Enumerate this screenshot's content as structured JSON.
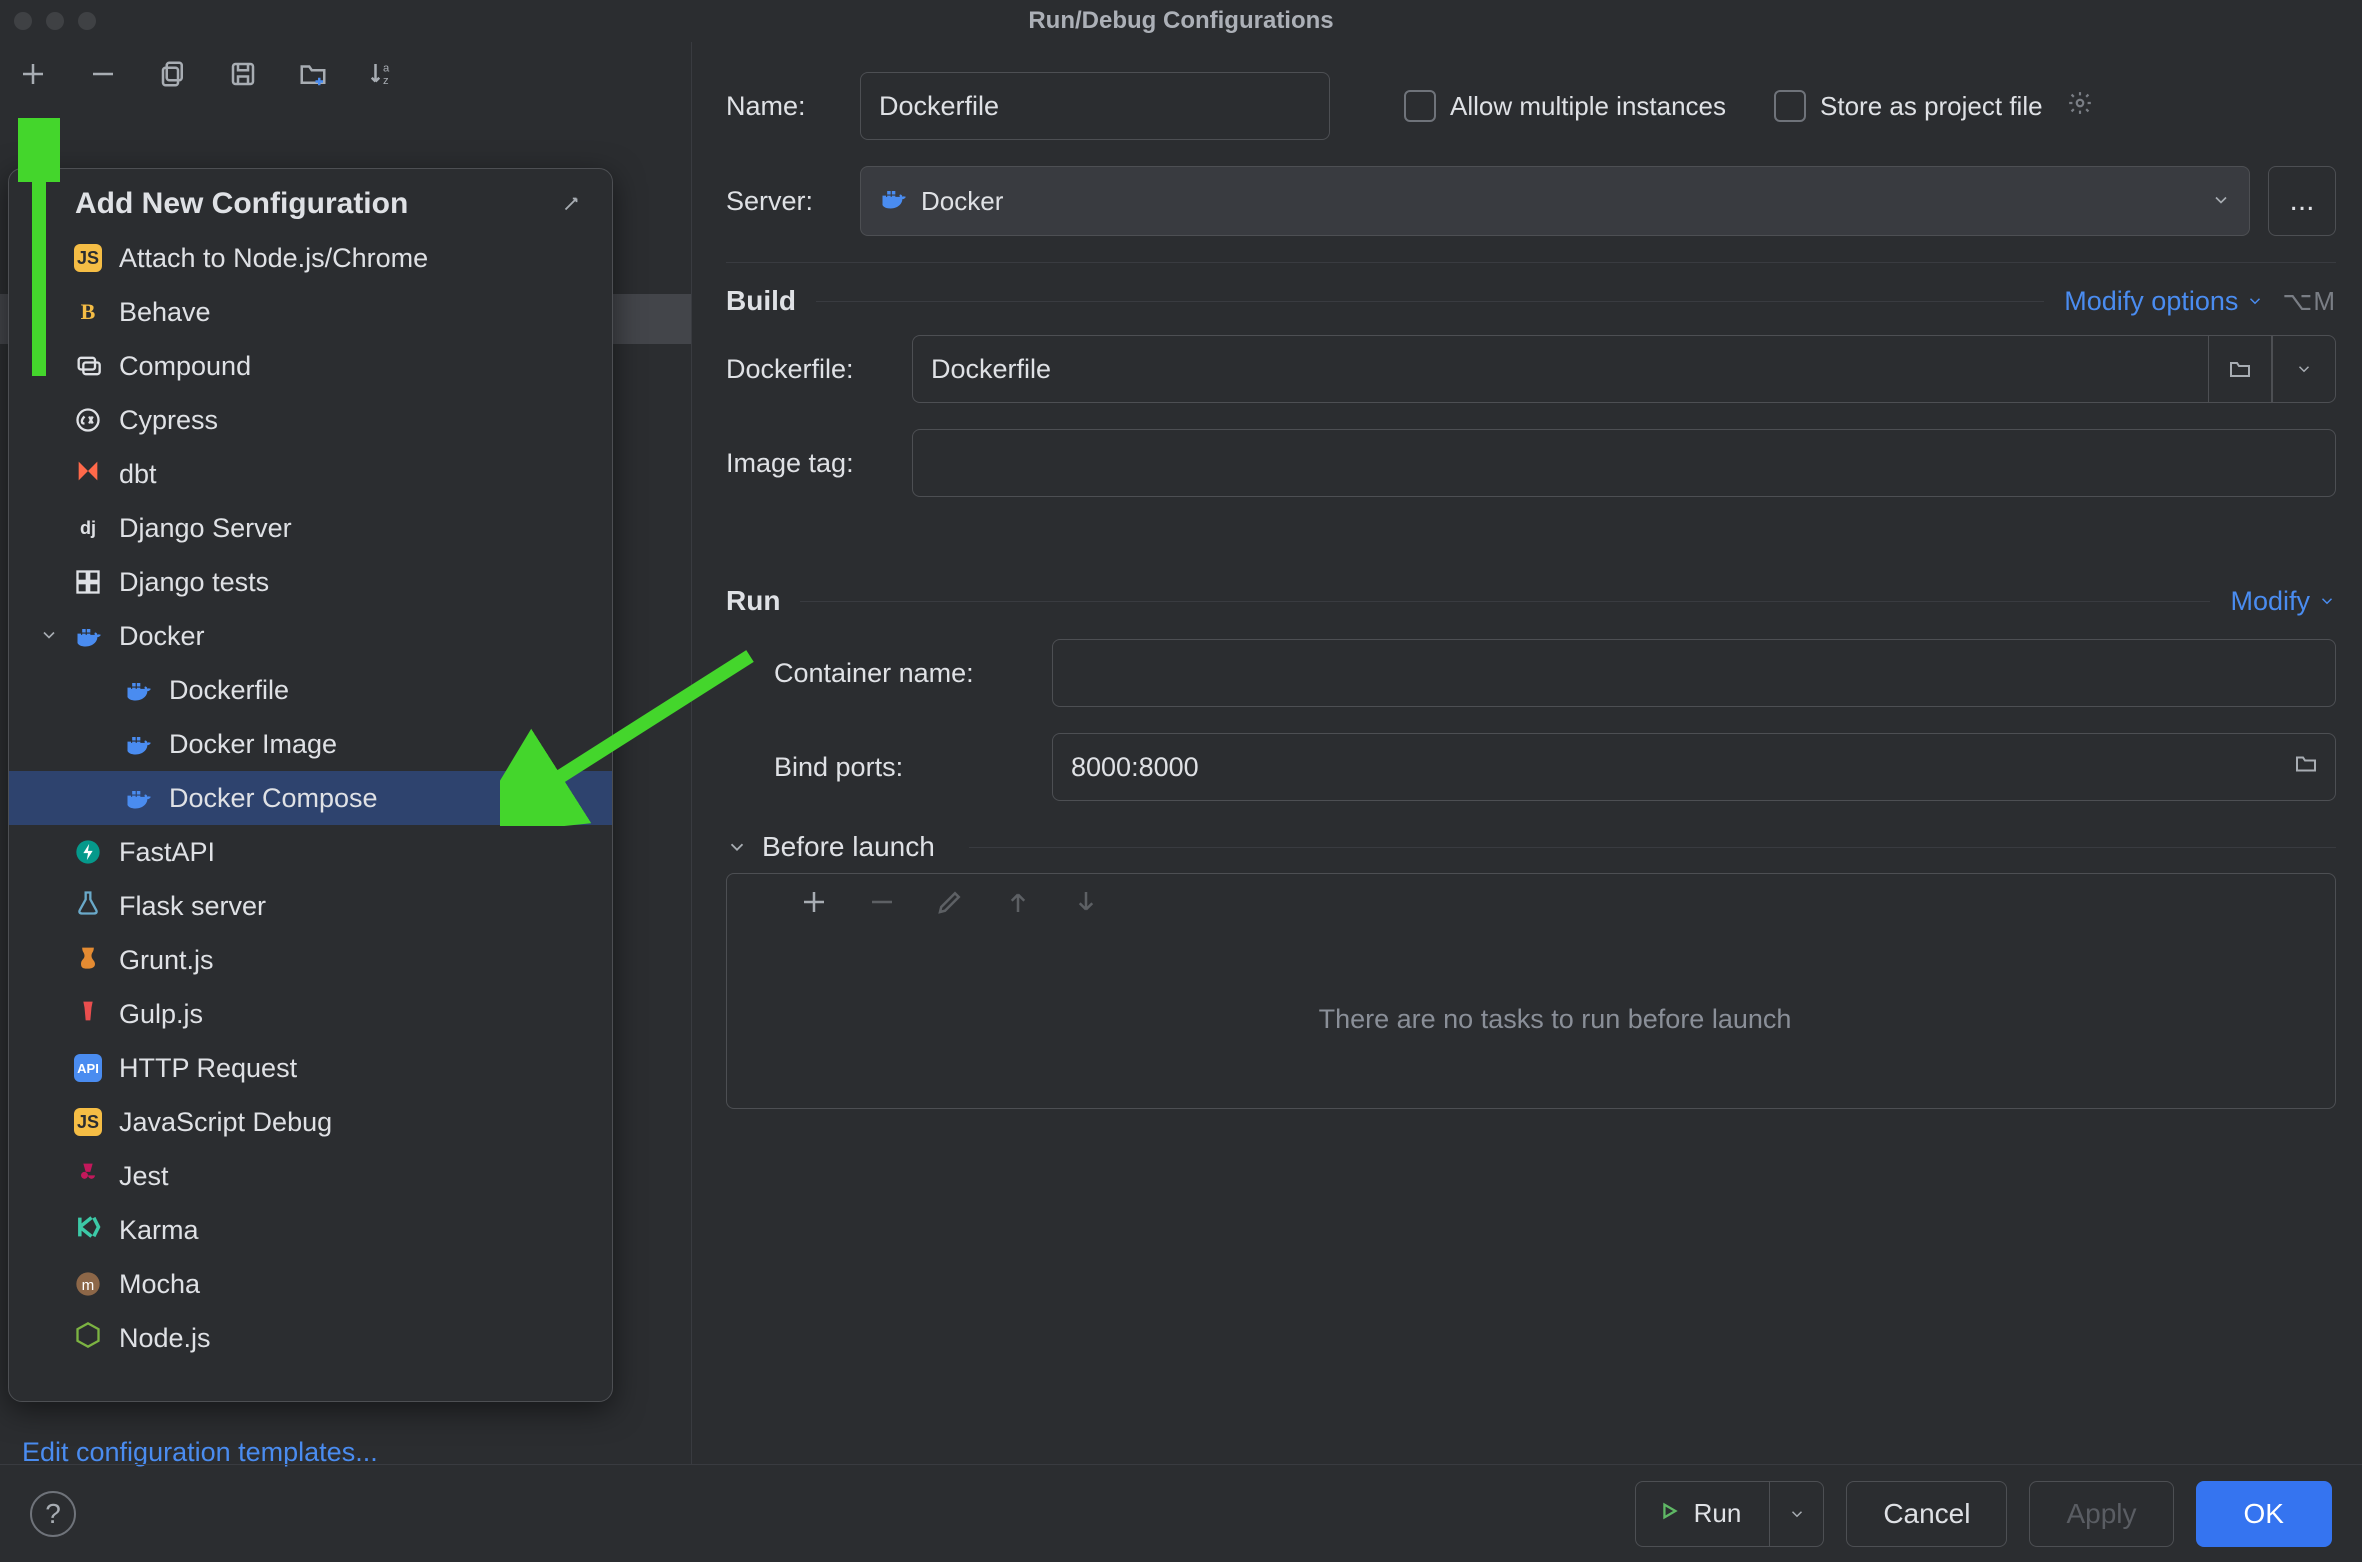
{
  "title": "Run/Debug Configurations",
  "toolbar": [
    "add",
    "remove",
    "copy",
    "save",
    "folder",
    "sort"
  ],
  "left": {
    "edit_templates": "Edit configuration templates..."
  },
  "popup": {
    "title": "Add New Configuration",
    "items": [
      {
        "label": "Attach to Node.js/Chrome",
        "icon": "js"
      },
      {
        "label": "Behave",
        "icon": "behave"
      },
      {
        "label": "Compound",
        "icon": "compound"
      },
      {
        "label": "Cypress",
        "icon": "cypress"
      },
      {
        "label": "dbt",
        "icon": "dbt"
      },
      {
        "label": "Django Server",
        "icon": "django"
      },
      {
        "label": "Django tests",
        "icon": "djangotest"
      },
      {
        "label": "Docker",
        "icon": "docker",
        "expandable": true,
        "expanded": true,
        "children": [
          {
            "label": "Dockerfile",
            "icon": "docker"
          },
          {
            "label": "Docker Image",
            "icon": "docker"
          },
          {
            "label": "Docker Compose",
            "icon": "docker",
            "selected": true
          }
        ]
      },
      {
        "label": "FastAPI",
        "icon": "fastapi"
      },
      {
        "label": "Flask server",
        "icon": "flask"
      },
      {
        "label": "Grunt.js",
        "icon": "grunt"
      },
      {
        "label": "Gulp.js",
        "icon": "gulp"
      },
      {
        "label": "HTTP Request",
        "icon": "http"
      },
      {
        "label": "JavaScript Debug",
        "icon": "js"
      },
      {
        "label": "Jest",
        "icon": "jest"
      },
      {
        "label": "Karma",
        "icon": "karma"
      },
      {
        "label": "Mocha",
        "icon": "mocha"
      },
      {
        "label": "Node.js",
        "icon": "node"
      }
    ]
  },
  "form": {
    "name_label": "Name:",
    "name_value": "Dockerfile",
    "allow_multi": "Allow multiple instances",
    "store_project": "Store as project file",
    "server_label": "Server:",
    "server_value": "Docker",
    "build_title": "Build",
    "modify_options": "Modify options",
    "modify_shortcut": "⌥M",
    "dockerfile_label": "Dockerfile:",
    "dockerfile_value": "Dockerfile",
    "image_tag_label": "Image tag:",
    "image_tag_value": "",
    "run_title": "Run",
    "modify": "Modify",
    "container_label": "Container name:",
    "container_value": "",
    "bind_label": "Bind ports:",
    "bind_value": "8000:8000",
    "before_title": "Before launch",
    "before_empty": "There are no tasks to run before launch"
  },
  "footer": {
    "run": "Run",
    "cancel": "Cancel",
    "apply": "Apply",
    "ok": "OK"
  }
}
